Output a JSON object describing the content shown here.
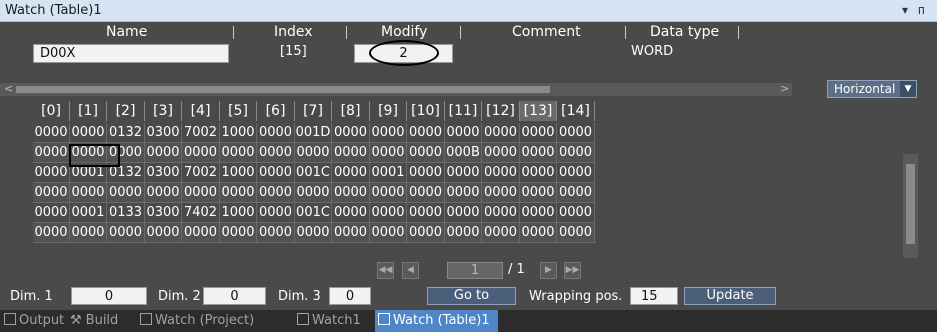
{
  "window": {
    "title": "Watch (Table)1",
    "ctrl_dropdown": "▾",
    "ctrl_pin": "ᴨ"
  },
  "header": {
    "name_label": "Name",
    "index_label": "Index",
    "modify_label": "Modify",
    "comment_label": "Comment",
    "datatype_label": "Data type",
    "name_value": "D00X",
    "index_value": "[15]",
    "modify_value": "2",
    "datatype_value": "WORD"
  },
  "layout_dropdown": {
    "label": "Horizontal"
  },
  "grid": {
    "columns": [
      "[0]",
      "[1]",
      "[2]",
      "[3]",
      "[4]",
      "[5]",
      "[6]",
      "[7]",
      "[8]",
      "[9]",
      "[10]",
      "[11]",
      "[12]",
      "[13]",
      "[14]"
    ],
    "selected_column": 13,
    "rows": [
      [
        "0000",
        "0000",
        "0132",
        "0300",
        "7002",
        "1000",
        "0000",
        "001D",
        "0000",
        "0000",
        "0000",
        "0000",
        "0000",
        "0000",
        "0000"
      ],
      [
        "0000",
        "0000",
        "0000",
        "0000",
        "0000",
        "0000",
        "0000",
        "0000",
        "0000",
        "0000",
        "0000",
        "000B",
        "0000",
        "0000",
        "0000"
      ],
      [
        "0000",
        "0001",
        "0132",
        "0300",
        "7002",
        "1000",
        "0000",
        "001C",
        "0000",
        "0001",
        "0000",
        "0000",
        "0000",
        "0000",
        "0000"
      ],
      [
        "0000",
        "0000",
        "0000",
        "0000",
        "0000",
        "0000",
        "0000",
        "0000",
        "0000",
        "0000",
        "0000",
        "0000",
        "0000",
        "0000",
        "0000"
      ],
      [
        "0000",
        "0001",
        "0133",
        "0300",
        "7402",
        "1000",
        "0000",
        "001C",
        "0000",
        "0000",
        "0000",
        "0000",
        "0000",
        "0000",
        "0000"
      ],
      [
        "0000",
        "0000",
        "0000",
        "0000",
        "0000",
        "0000",
        "0000",
        "0000",
        "0000",
        "0000",
        "0000",
        "0000",
        "0000",
        "0000",
        "0000"
      ]
    ]
  },
  "pager": {
    "current": "1",
    "total": "/ 1"
  },
  "dims": {
    "dim1_label": "Dim. 1",
    "dim1_value": "0",
    "dim2_label": "Dim. 2",
    "dim2_value": "0",
    "dim3_label": "Dim. 3",
    "dim3_value": "0",
    "goto_label": "Go to",
    "wrap_label": "Wrapping pos.",
    "wrap_value": "15",
    "update_label": "Update"
  },
  "tabs": [
    {
      "label": "Output",
      "active": false
    },
    {
      "label": "Build",
      "active": false
    },
    {
      "label": "Watch (Project)",
      "active": false
    },
    {
      "label": "Watch1",
      "active": false
    },
    {
      "label": "Watch (Table)1",
      "active": true
    }
  ]
}
